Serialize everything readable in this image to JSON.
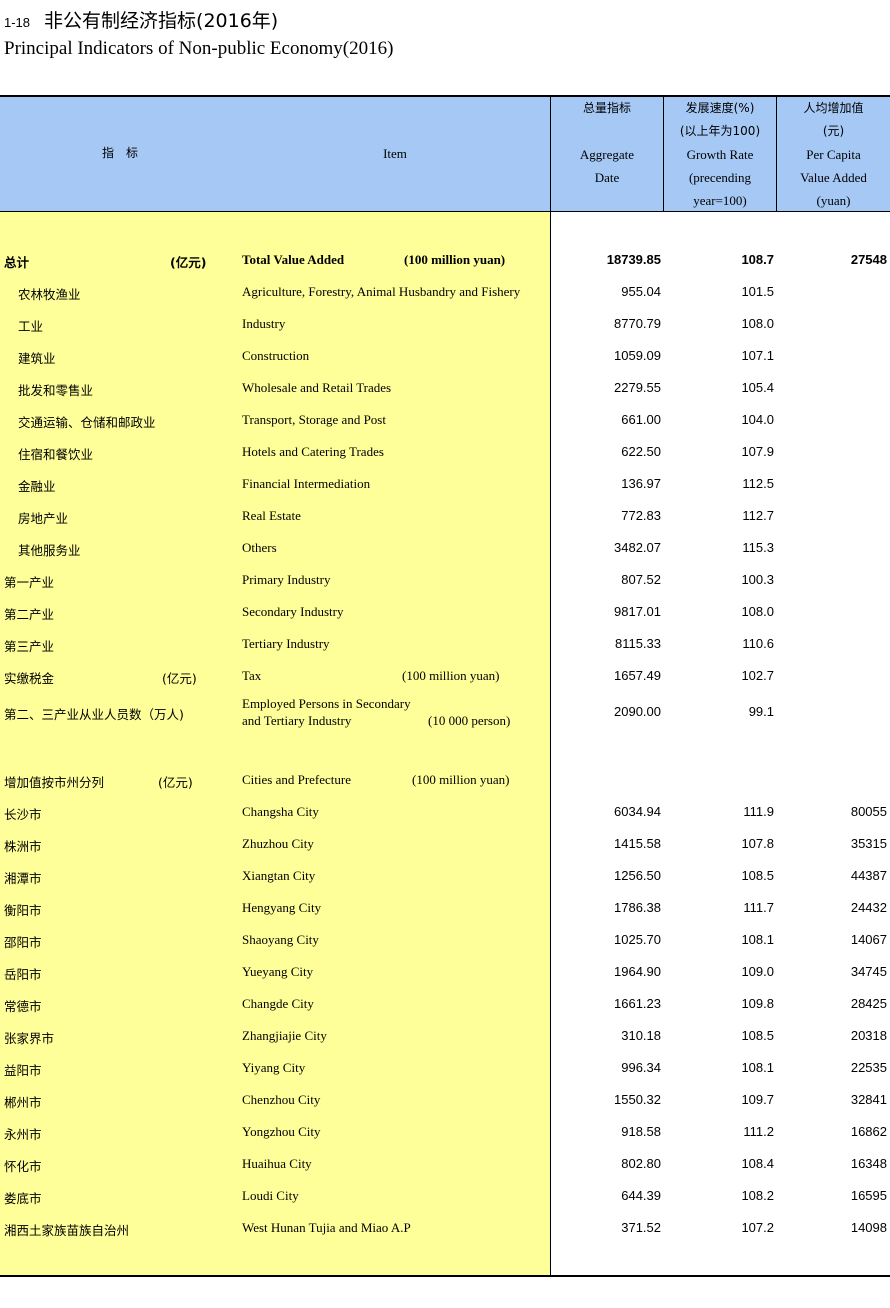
{
  "title": {
    "number": "1-18",
    "zh": "非公有制经济指标(2016年)",
    "en": "Principal Indicators of Non-public Economy(2016)"
  },
  "header": {
    "indicator_zh": "指　标",
    "item_en": "Item",
    "aggregate": {
      "zh": "总量指标",
      "en1": "Aggregate",
      "en2": "Date"
    },
    "growth": {
      "zh1": "发展速度(%)",
      "zh2": "(以上年为100)",
      "en1": "Growth Rate",
      "en2": "(precending",
      "en3": "year=100)"
    },
    "percapita": {
      "zh1": "人均增加值",
      "zh2": "(元)",
      "en1": "Per Capita",
      "en2": "Value Added",
      "en3": "(yuan)"
    }
  },
  "total_row": {
    "zh": "总计",
    "unit_zh": "(亿元)",
    "en": "Total Value Added",
    "unit_en": "(100 million yuan)",
    "aggregate": "18739.85",
    "growth": "108.7",
    "percapita": "27548"
  },
  "sector_rows": [
    {
      "zh": "农林牧渔业",
      "en": "Agriculture, Forestry, Animal Husbandry and Fishery",
      "aggregate": "955.04",
      "growth": "101.5"
    },
    {
      "zh": "工业",
      "en": "Industry",
      "aggregate": "8770.79",
      "growth": "108.0"
    },
    {
      "zh": "建筑业",
      "en": "Construction",
      "aggregate": "1059.09",
      "growth": "107.1"
    },
    {
      "zh": "批发和零售业",
      "en": "Wholesale and Retail Trades",
      "aggregate": "2279.55",
      "growth": "105.4"
    },
    {
      "zh": "交通运输、仓储和邮政业",
      "en": "Transport, Storage and Post",
      "aggregate": "661.00",
      "growth": "104.0"
    },
    {
      "zh": "住宿和餐饮业",
      "en": "Hotels and Catering Trades",
      "aggregate": "622.50",
      "growth": "107.9"
    },
    {
      "zh": "金融业",
      "en": "Financial Intermediation",
      "aggregate": "136.97",
      "growth": "112.5"
    },
    {
      "zh": "房地产业",
      "en": "Real Estate",
      "aggregate": "772.83",
      "growth": "112.7"
    },
    {
      "zh": "其他服务业",
      "en": "Others",
      "aggregate": "3482.07",
      "growth": "115.3"
    }
  ],
  "industry_rows": [
    {
      "zh": "第一产业",
      "en": "Primary Industry",
      "aggregate": "807.52",
      "growth": "100.3"
    },
    {
      "zh": "第二产业",
      "en": "Secondary Industry",
      "aggregate": "9817.01",
      "growth": "108.0"
    },
    {
      "zh": "第三产业",
      "en": "Tertiary Industry",
      "aggregate": "8115.33",
      "growth": "110.6"
    }
  ],
  "tax_row": {
    "zh": "实缴税金",
    "unit_zh": "(亿元)",
    "en": "Tax",
    "unit_en": "(100 million yuan)",
    "aggregate": "1657.49",
    "growth": "102.7"
  },
  "employed_row": {
    "zh": "第二、三产业从业人员数（万人)",
    "en1": "Employed Persons in Secondary",
    "en2": "and Tertiary Industry",
    "unit_en": "(10 000 person)",
    "aggregate": "2090.00",
    "growth": "99.1"
  },
  "cities_header": {
    "zh": "增加值按市州分列",
    "unit_zh": "(亿元)",
    "en": "Cities and Prefecture",
    "unit_en": "(100 million yuan)"
  },
  "city_rows": [
    {
      "zh": "长沙市",
      "en": "Changsha City",
      "aggregate": "6034.94",
      "growth": "111.9",
      "percapita": "80055"
    },
    {
      "zh": "株洲市",
      "en": "Zhuzhou City",
      "aggregate": "1415.58",
      "growth": "107.8",
      "percapita": "35315"
    },
    {
      "zh": "湘潭市",
      "en": "Xiangtan City",
      "aggregate": "1256.50",
      "growth": "108.5",
      "percapita": "44387"
    },
    {
      "zh": "衡阳市",
      "en": "Hengyang City",
      "aggregate": "1786.38",
      "growth": "111.7",
      "percapita": "24432"
    },
    {
      "zh": "邵阳市",
      "en": "Shaoyang City",
      "aggregate": "1025.70",
      "growth": "108.1",
      "percapita": "14067"
    },
    {
      "zh": "岳阳市",
      "en": "Yueyang City",
      "aggregate": "1964.90",
      "growth": "109.0",
      "percapita": "34745"
    },
    {
      "zh": "常德市",
      "en": "Changde City",
      "aggregate": "1661.23",
      "growth": "109.8",
      "percapita": "28425"
    },
    {
      "zh": "张家界市",
      "en": "Zhangjiajie City",
      "aggregate": "310.18",
      "growth": "108.5",
      "percapita": "20318"
    },
    {
      "zh": "益阳市",
      "en": "Yiyang City",
      "aggregate": "996.34",
      "growth": "108.1",
      "percapita": "22535"
    },
    {
      "zh": "郴州市",
      "en": "Chenzhou City",
      "aggregate": "1550.32",
      "growth": "109.7",
      "percapita": "32841"
    },
    {
      "zh": "永州市",
      "en": "Yongzhou City",
      "aggregate": "918.58",
      "growth": "111.2",
      "percapita": "16862"
    },
    {
      "zh": "怀化市",
      "en": "Huaihua City",
      "aggregate": "802.80",
      "growth": "108.4",
      "percapita": "16348"
    },
    {
      "zh": "娄底市",
      "en": "Loudi City",
      "aggregate": "644.39",
      "growth": "108.2",
      "percapita": "16595"
    },
    {
      "zh": "湘西土家族苗族自治州",
      "en": "West Hunan Tujia and Miao A.P",
      "aggregate": "371.52",
      "growth": "107.2",
      "percapita": "14098"
    }
  ]
}
